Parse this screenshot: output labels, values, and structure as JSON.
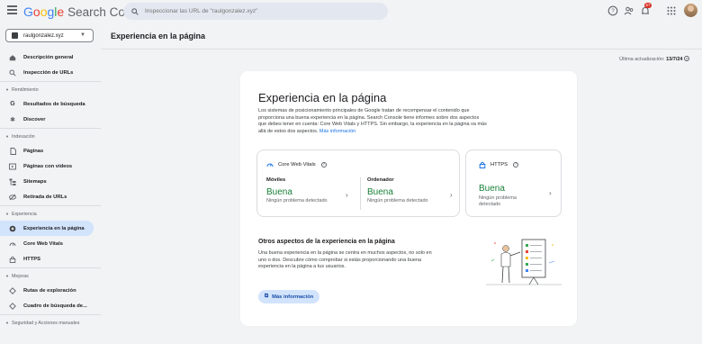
{
  "header": {
    "logo_google": "Google",
    "logo_product": "Search Console",
    "search_placeholder": "Inspeccionar las URL de \"raulgonzalez.xyz\"",
    "notification_count": "57"
  },
  "property_selector": {
    "label": "raulgonzalez.xyz"
  },
  "sidebar": {
    "items_top": [
      {
        "label": "Descripción general",
        "icon": "home-icon"
      },
      {
        "label": "Inspección de URLs",
        "icon": "search-icon"
      }
    ],
    "sections": [
      {
        "title": "Rendimiento",
        "items": [
          {
            "label": "Resultados de búsqueda",
            "icon": "google-g-icon"
          },
          {
            "label": "Discover",
            "icon": "asterisk-icon"
          }
        ]
      },
      {
        "title": "Indexación",
        "items": [
          {
            "label": "Páginas",
            "icon": "file-icon"
          },
          {
            "label": "Páginas con vídeos",
            "icon": "video-file-icon"
          },
          {
            "label": "Sitemaps",
            "icon": "sitemap-icon"
          },
          {
            "label": "Retirada de URLs",
            "icon": "eye-off-icon"
          }
        ]
      },
      {
        "title": "Experiencia",
        "items": [
          {
            "label": "Experiencia en la página",
            "icon": "sparkle-icon",
            "active": true
          },
          {
            "label": "Core Web Vitals",
            "icon": "gauge-icon"
          },
          {
            "label": "HTTPS",
            "icon": "lock-icon"
          }
        ]
      },
      {
        "title": "Mejoras",
        "items": [
          {
            "label": "Rutas de exploración",
            "icon": "diamond-icon"
          },
          {
            "label": "Cuadro de búsqueda de...",
            "icon": "diamond-icon"
          }
        ]
      },
      {
        "title": "Seguridad y Acciones manuales",
        "items": []
      }
    ]
  },
  "page": {
    "title": "Experiencia en la página",
    "updated_label": "Última actualización:",
    "updated_date": "13/7/24"
  },
  "card": {
    "heading": "Experiencia en la página",
    "intro": "Los sistemas de posicionamiento principales de Google tratan de recompensar el contenido que proporciona una buena experiencia en la página. Search Console tiene informes sobre dos aspectos que debes tener en cuenta: Core Web Vitals y HTTPS. Sin embargo, la experiencia en la página va más allá de estos dos aspectos.",
    "intro_link": "Más información",
    "cwv": {
      "title": "Core Web Vitals",
      "mobile": {
        "label": "Móviles",
        "status": "Buena",
        "detail": "Ningún problema detectado"
      },
      "desktop": {
        "label": "Ordenador",
        "status": "Buena",
        "detail": "Ningún problema detectado"
      }
    },
    "https": {
      "title": "HTTPS",
      "status": "Buena",
      "detail": "Ningún problema detectado"
    },
    "other": {
      "heading": "Otros aspectos de la experiencia en la página",
      "text": "Una buena experiencia en la página se centra en muchos aspectos, no solo en uno o dos. Descubre cómo comprobar si estás proporcionando una buena experiencia en la página a tus usuarios.",
      "button": "Más información"
    },
    "status_color": "#188038"
  }
}
